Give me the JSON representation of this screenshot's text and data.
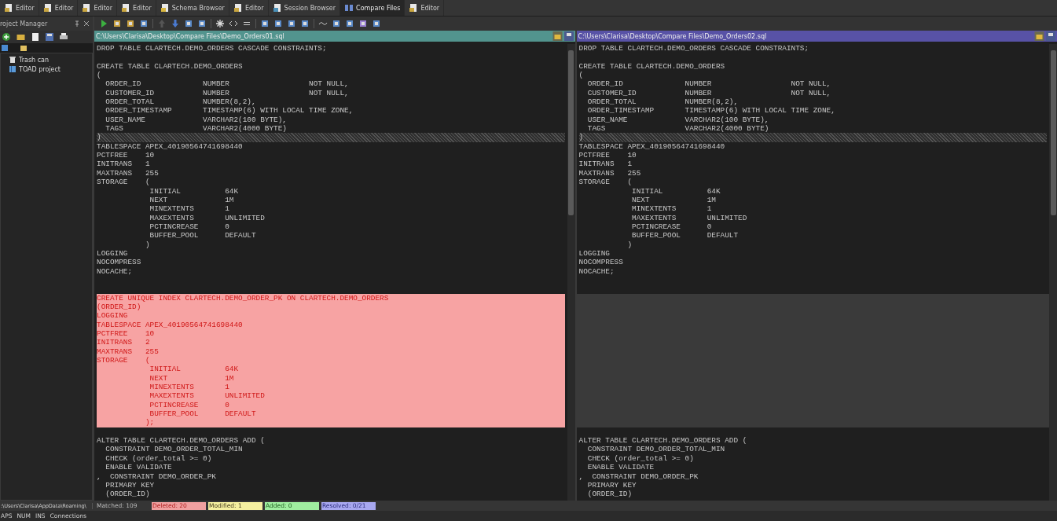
{
  "tabs": [
    {
      "label": "Editor",
      "kind": "editor",
      "selected": false
    },
    {
      "label": "Editor",
      "kind": "editor",
      "selected": false
    },
    {
      "label": "Editor",
      "kind": "editor",
      "selected": false
    },
    {
      "label": "Editor",
      "kind": "editor",
      "selected": false
    },
    {
      "label": "Schema Browser",
      "kind": "schema",
      "selected": false
    },
    {
      "label": "Editor",
      "kind": "editor",
      "selected": false
    },
    {
      "label": "Session Browser",
      "kind": "session",
      "selected": false
    },
    {
      "label": "Compare Files",
      "kind": "compare",
      "selected": true
    },
    {
      "label": "Editor",
      "kind": "editor",
      "selected": false
    }
  ],
  "project_manager": {
    "title": "roject Manager",
    "tree": [
      {
        "label": "Trash can",
        "kind": "trash"
      },
      {
        "label": "TOAD project",
        "kind": "project"
      }
    ]
  },
  "left_file": {
    "path": "C:\\Users\\Clarisa\\Desktop\\Compare Files\\Demo_Orders01.sql"
  },
  "right_file": {
    "path": "C:\\Users\\Clarisa\\Desktop\\Compare Files\\Demo_Orders02.sql"
  },
  "blocks": [
    {
      "kind": "equal",
      "left": "DROP TABLE CLARTECH.DEMO_ORDERS CASCADE CONSTRAINTS;\n\nCREATE TABLE CLARTECH.DEMO_ORDERS\n(\n  ORDER_ID              NUMBER                  NOT NULL,\n  CUSTOMER_ID           NUMBER                  NOT NULL,\n  ORDER_TOTAL           NUMBER(8,2),\n  ORDER_TIMESTAMP       TIMESTAMP(6) WITH LOCAL TIME ZONE,\n  USER_NAME             VARCHAR2(100 BYTE),\n  TAGS                  VARCHAR2(4000 BYTE)",
      "right": "DROP TABLE CLARTECH.DEMO_ORDERS CASCADE CONSTRAINTS;\n\nCREATE TABLE CLARTECH.DEMO_ORDERS\n(\n  ORDER_ID              NUMBER                  NOT NULL,\n  CUSTOMER_ID           NUMBER                  NOT NULL,\n  ORDER_TOTAL           NUMBER(8,2),\n  ORDER_TIMESTAMP       TIMESTAMP(6) WITH LOCAL TIME ZONE,\n  USER_NAME             VARCHAR2(100 BYTE),\n  TAGS                  VARCHAR2(4000 BYTE)"
    },
    {
      "kind": "modified",
      "left": ")",
      "right": ")"
    },
    {
      "kind": "equal",
      "left": "TABLESPACE APEX_40190564741698440\nPCTFREE    10\nINITRANS   1\nMAXTRANS   255\nSTORAGE    (\n            INITIAL          64K\n            NEXT             1M\n            MINEXTENTS       1\n            MAXEXTENTS       UNLIMITED\n            PCTINCREASE      0\n            BUFFER_POOL      DEFAULT\n           )\nLOGGING\nNOCOMPRESS\nNOCACHE;\n\n",
      "right": "TABLESPACE APEX_40190564741698440\nPCTFREE    10\nINITRANS   1\nMAXTRANS   255\nSTORAGE    (\n            INITIAL          64K\n            NEXT             1M\n            MINEXTENTS       1\n            MAXEXTENTS       UNLIMITED\n            PCTINCREASE      0\n            BUFFER_POOL      DEFAULT\n           )\nLOGGING\nNOCOMPRESS\nNOCACHE;\n\n"
    },
    {
      "kind": "deleted",
      "left": "CREATE UNIQUE INDEX CLARTECH.DEMO_ORDER_PK ON CLARTECH.DEMO_ORDERS\n(ORDER_ID)\nLOGGING\nTABLESPACE APEX_40190564741698440\nPCTFREE    10\nINITRANS   2\nMAXTRANS   255\nSTORAGE    (\n            INITIAL          64K\n            NEXT             1M\n            MINEXTENTS       1\n            MAXEXTENTS       UNLIMITED\n            PCTINCREASE      0\n            BUFFER_POOL      DEFAULT\n           );"
    },
    {
      "kind": "equal",
      "left": "\nALTER TABLE CLARTECH.DEMO_ORDERS ADD (\n  CONSTRAINT DEMO_ORDER_TOTAL_MIN\n  CHECK (order_total >= 0)\n  ENABLE VALIDATE\n,  CONSTRAINT DEMO_ORDER_PK\n  PRIMARY KEY\n  (ORDER_ID)",
      "right": "\nALTER TABLE CLARTECH.DEMO_ORDERS ADD (\n  CONSTRAINT DEMO_ORDER_TOTAL_MIN\n  CHECK (order_total >= 0)\n  ENABLE VALIDATE\n,  CONSTRAINT DEMO_ORDER_PK\n  PRIMARY KEY\n  (ORDER_ID)"
    }
  ],
  "status_bar": {
    "path": ":\\Users\\Clarisa\\AppData\\Roaming\\",
    "counts": [
      {
        "label": "Matched: 109",
        "kind": "matched"
      },
      {
        "label": "Deleted: 20",
        "kind": "deleted"
      },
      {
        "label": "Modified: 1",
        "kind": "modified"
      },
      {
        "label": "Added: 0",
        "kind": "added"
      },
      {
        "label": "Resolved: 0/21",
        "kind": "resolved"
      }
    ]
  },
  "bottom_bar": [
    "APS",
    "NUM",
    "INS",
    "Connections"
  ]
}
